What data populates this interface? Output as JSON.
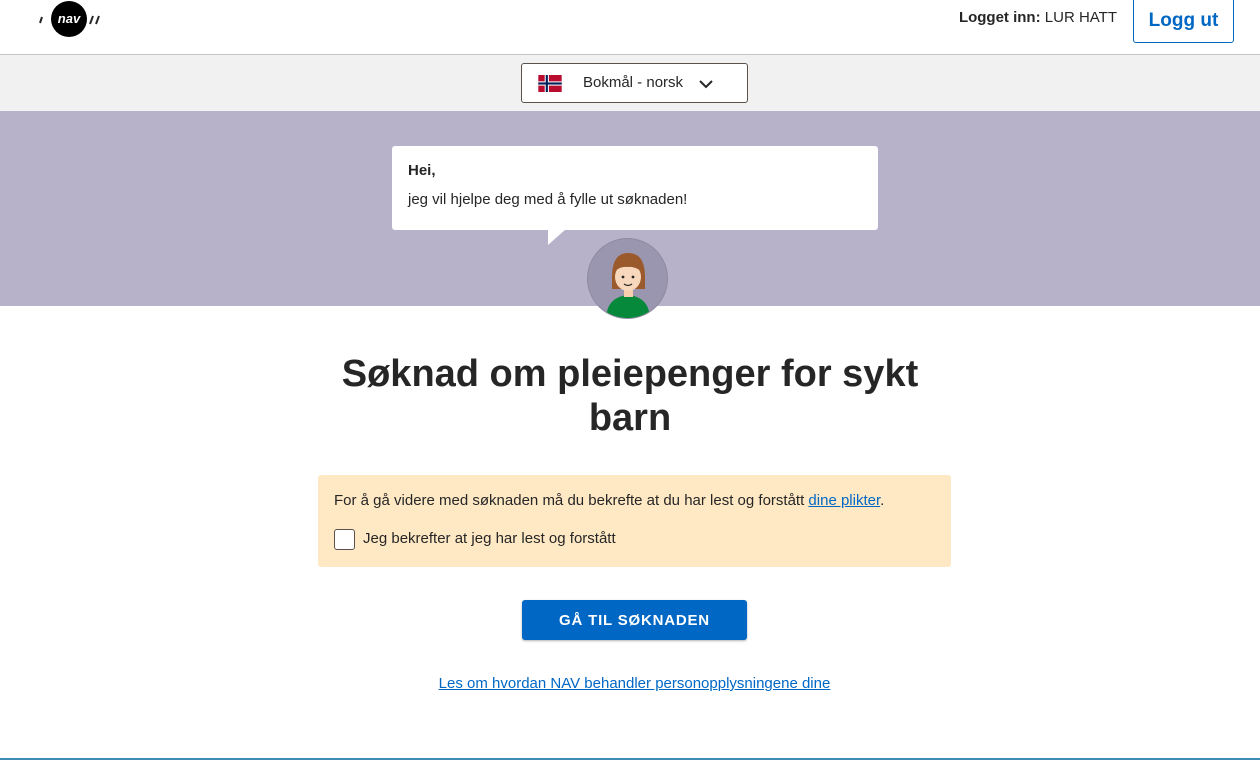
{
  "header": {
    "logo_text": "nav",
    "logged_in_label": "Logget inn:",
    "user_name": "LUR HATT",
    "logout_label": "Logg ut"
  },
  "language": {
    "selected": "Bokmål - norsk",
    "flag_icon": "norway-flag-icon"
  },
  "guide": {
    "greeting": "Hei,",
    "message": "jeg vil hjelpe deg med å fylle ut søknaden!"
  },
  "main": {
    "title_line1": "Søknad om pleiepenger for sykt",
    "title_line2": "barn",
    "confirm_text_before": "For å gå videre med søknaden må du bekrefte at du har lest og forstått ",
    "confirm_link": "dine plikter",
    "confirm_text_after": ".",
    "checkbox_label": "Jeg bekrefter at jeg har lest og forstått",
    "checkbox_checked": false,
    "primary_button": "GÅ TIL SØKNADEN",
    "privacy_link": "Les om hvordan NAV behandler personopplysningene dine"
  },
  "colors": {
    "brand_blue": "#0067c5",
    "banner": "#b7b1c9",
    "panel": "#ffe9c5",
    "logo_red": "#c30000"
  }
}
